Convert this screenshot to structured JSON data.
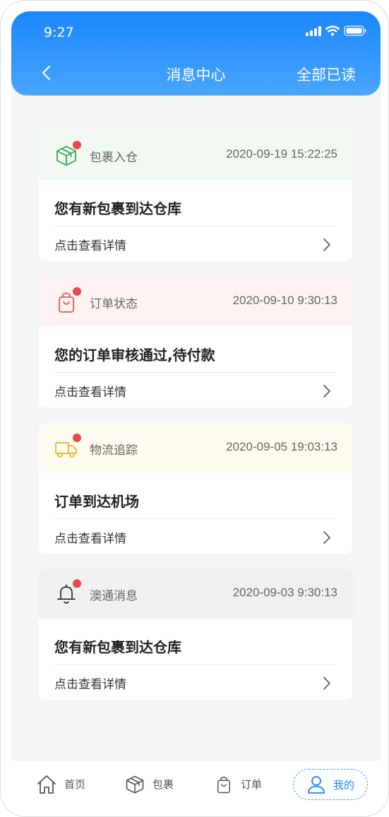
{
  "status": {
    "time": "9:27"
  },
  "nav": {
    "title": "消息中心",
    "action": "全部已读"
  },
  "messages": [
    {
      "type": "包裹入仓",
      "time": "2020-09-19 15:22:25",
      "text": "您有新包裹到达仓库",
      "link": "点击查看详情",
      "icon": "package-icon",
      "head_bg": "#f2f9f3",
      "icon_color": "#3aa457"
    },
    {
      "type": "订单状态",
      "time": "2020-09-10 9:30:13",
      "text": "您的订单审核通过,待付款",
      "link": "点击查看详情",
      "icon": "shopping-bag-icon",
      "head_bg": "#fdf3f2",
      "icon_color": "#e15a55"
    },
    {
      "type": "物流追踪",
      "time": "2020-09-05 19:03:13",
      "text": "订单到达机场",
      "link": "点击查看详情",
      "icon": "truck-icon",
      "head_bg": "#fffbf0",
      "icon_color": "#efb427"
    },
    {
      "type": "澳通消息",
      "time": "2020-09-03 9:30:13",
      "text": "您有新包裹到达仓库",
      "link": "点击查看详情",
      "icon": "bell-icon",
      "head_bg": "#f0f0f0",
      "icon_color": "#333333"
    }
  ],
  "tabs": [
    {
      "label": "首页",
      "icon": "home-icon"
    },
    {
      "label": "包裹",
      "icon": "package-icon"
    },
    {
      "label": "订单",
      "icon": "shopping-bag-icon"
    },
    {
      "label": "我的",
      "icon": "user-icon",
      "active": true
    }
  ],
  "colors": {
    "header": "#1a86fb",
    "unread_dot": "#e8494d",
    "active_tab": "#1a86fb"
  }
}
